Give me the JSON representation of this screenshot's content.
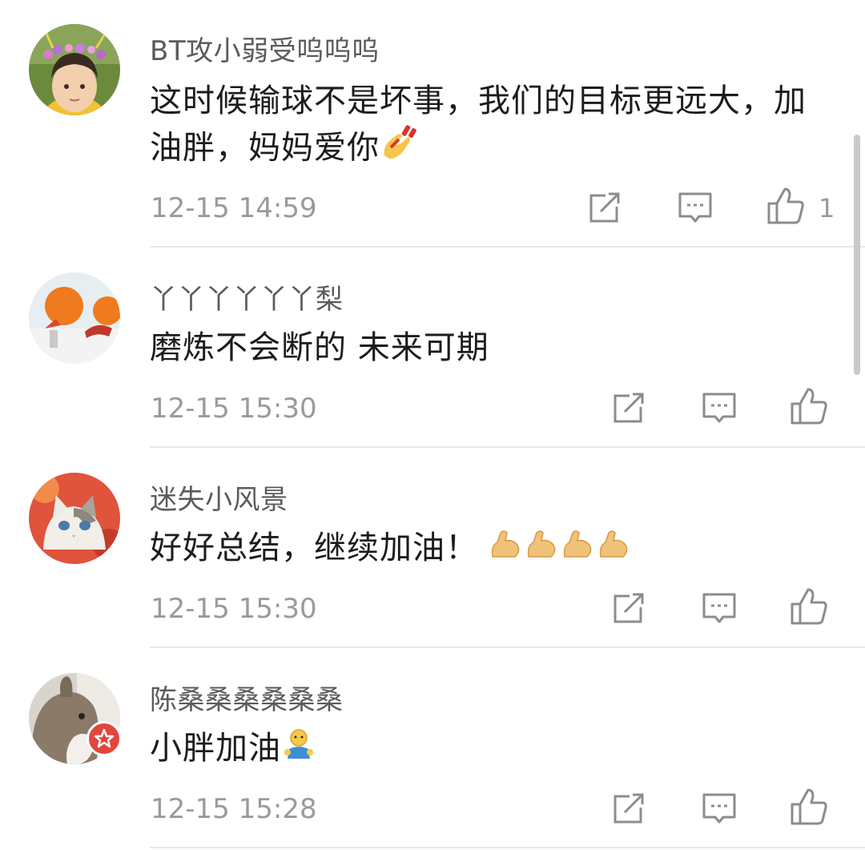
{
  "comments": [
    {
      "username": "BT攻小弱受呜呜呜",
      "text": "这时候输球不是坏事，我们的目标更远大，加油胖，妈妈爱你",
      "emoji": "nail-polish-emoji",
      "time": "12-15 14:59",
      "likes": "1",
      "avatar": "child-with-flower-crown-avatar"
    },
    {
      "username": "丫丫丫丫丫丫梨",
      "text": "磨炼不会断的 未来可期",
      "time": "12-15 15:30",
      "likes": "",
      "avatar": "orange-ping-pong-avatar"
    },
    {
      "username": "迷失小风景",
      "text": "好好总结，继续加油！",
      "emoji": "flexed-biceps-emoji x4",
      "time": "12-15 15:30",
      "likes": "",
      "avatar": "cat-avatar"
    },
    {
      "username": "陈桑桑桑桑桑桑",
      "text": "小胖加油",
      "emoji": "person-emoji",
      "time": "12-15 15:28",
      "likes": "",
      "avatar": "rabbit-avatar"
    }
  ],
  "icons": {
    "repost": "share-square-icon",
    "comment": "comment-bubble-icon",
    "like": "thumbs-up-icon"
  },
  "colors": {
    "text": "#1c1c1c",
    "username": "#5b5b5b",
    "meta": "#9a9a9a",
    "divider": "#e8e8e8",
    "badge": "#e2463c"
  }
}
